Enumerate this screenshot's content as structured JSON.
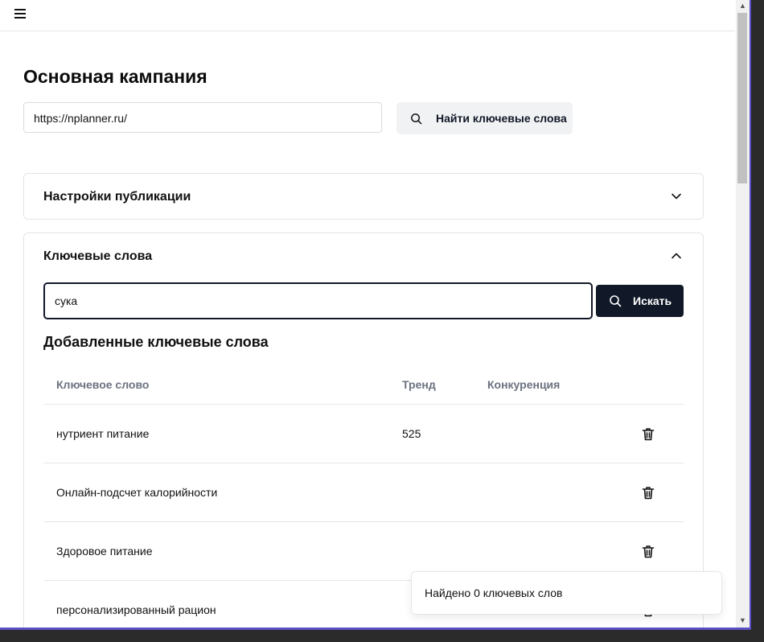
{
  "header": {
    "menu_icon": "hamburger-icon"
  },
  "campaign": {
    "title": "Основная кампания",
    "url_value": "https://nplanner.ru/",
    "find_button": "Найти ключевые слова",
    "find_icon": "search-icon"
  },
  "publication": {
    "title": "Настройки публикации",
    "icon": "chevron-down-icon"
  },
  "keywords": {
    "title": "Ключевые слова",
    "icon": "chevron-up-icon",
    "search_value": "сука",
    "search_button": "Искать",
    "added_title": "Добавленные ключевые слова",
    "columns": [
      "Ключевое слово",
      "Тренд",
      "Конкуренция"
    ],
    "rows": [
      {
        "keyword": "нутриент питание",
        "trend": "525",
        "competition": ""
      },
      {
        "keyword": "Онлайн-подсчет калорийности",
        "trend": "",
        "competition": ""
      },
      {
        "keyword": "Здоровое питание",
        "trend": "",
        "competition": ""
      },
      {
        "keyword": "персонализированный рацион",
        "trend": "",
        "competition": ""
      }
    ]
  },
  "toast": {
    "message": "Найдено 0 ключевых слов"
  },
  "colors": {
    "primary_button": "#111827",
    "secondary_button": "#f1f2f4",
    "window_border": "#5b4fc4"
  }
}
